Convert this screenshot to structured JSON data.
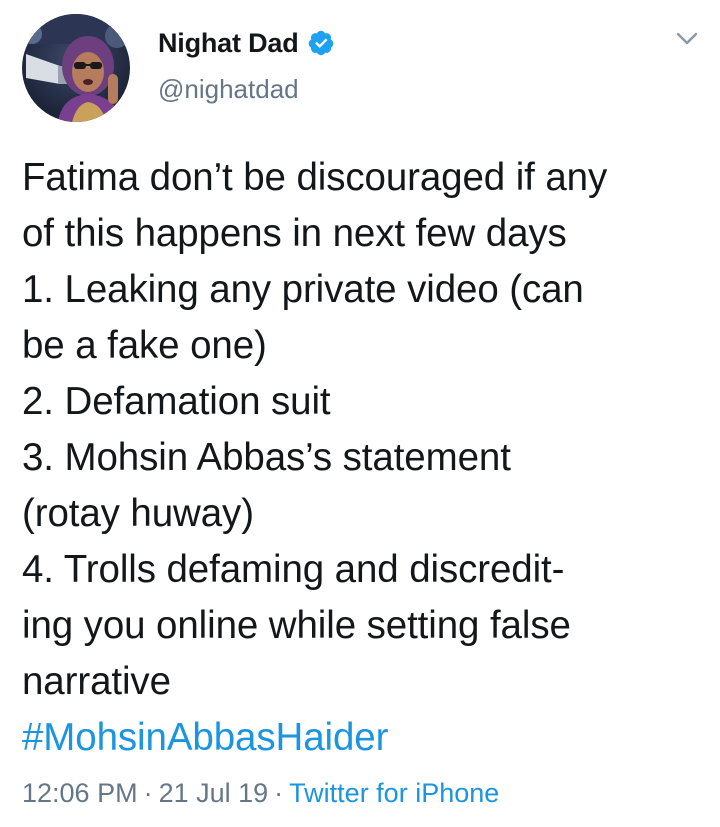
{
  "author": {
    "display_name": "Nighat Dad",
    "handle": "@nighatdad",
    "verified_icon": "verified-badge-icon",
    "avatar_icon": "profile-photo"
  },
  "menu_icon": "chevron-down-icon",
  "tweet": {
    "lines": [
      "Fatima don’t be discouraged if any",
      "of this happens in next few days",
      "1. Leaking any private video (can",
      "be a fake one)",
      "2. Defamation suit",
      "3. Mohsin Abbas’s statement",
      "(rotay huway)",
      "4. Trolls defaming and discredit-",
      "ing you online while setting false",
      "narrative"
    ],
    "hashtag": "#MohsinAbbasHaider"
  },
  "meta": {
    "time": "12:06 PM",
    "separator": "·",
    "date": "21 Jul 19",
    "source": "Twitter for iPhone"
  },
  "colors": {
    "link": "#1b95e0",
    "muted": "#657786",
    "text": "#14171a",
    "verified": "#1da1f2"
  }
}
